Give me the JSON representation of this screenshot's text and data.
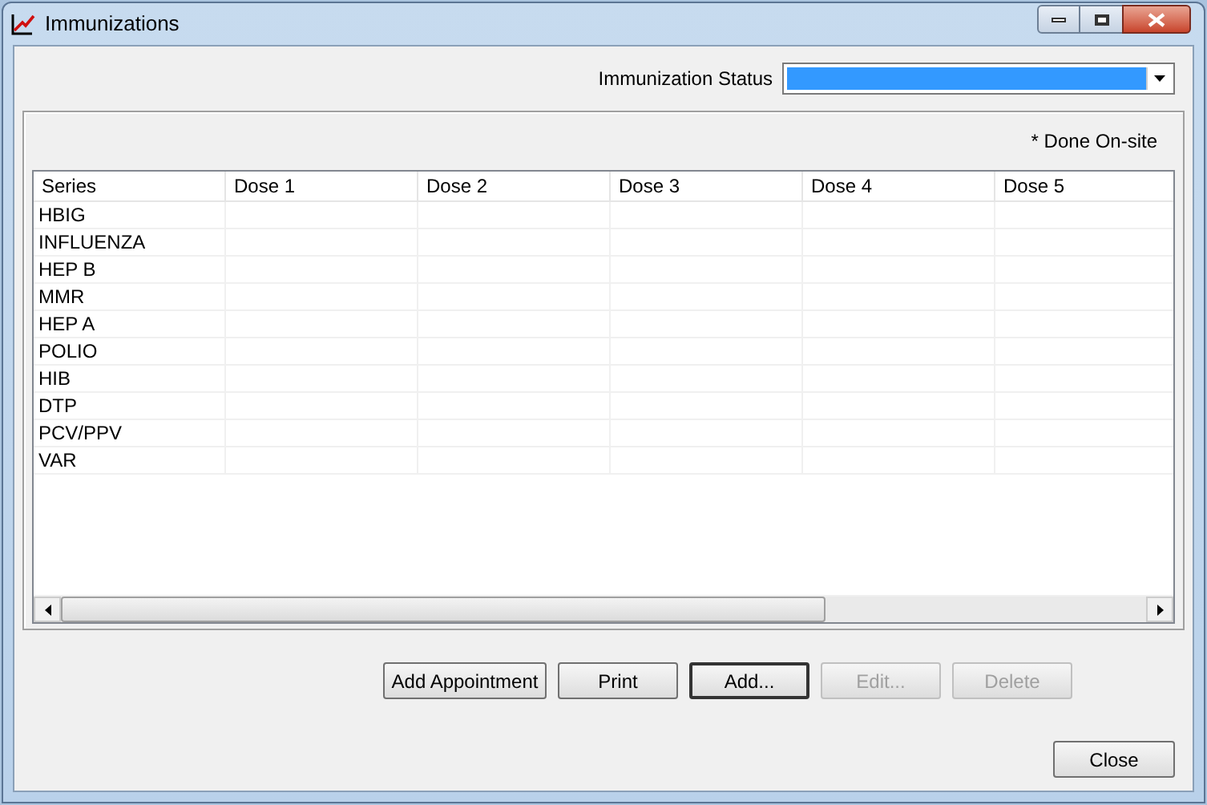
{
  "window": {
    "title": "Immunizations"
  },
  "status": {
    "label": "Immunization Status"
  },
  "legend": "* Done On-site",
  "table": {
    "columns": [
      "Series",
      "Dose 1",
      "Dose 2",
      "Dose 3",
      "Dose 4",
      "Dose 5"
    ],
    "rows": [
      {
        "series": "HBIG"
      },
      {
        "series": "INFLUENZA"
      },
      {
        "series": "HEP B"
      },
      {
        "series": "MMR"
      },
      {
        "series": "HEP A"
      },
      {
        "series": "POLIO"
      },
      {
        "series": "HIB"
      },
      {
        "series": "DTP"
      },
      {
        "series": "PCV/PPV"
      },
      {
        "series": "VAR"
      }
    ]
  },
  "buttons": [
    {
      "label": "Add Appointment",
      "disabled": false,
      "default": false
    },
    {
      "label": "Print",
      "disabled": false,
      "default": false
    },
    {
      "label": "Add...",
      "disabled": false,
      "default": true
    },
    {
      "label": "Edit...",
      "disabled": true,
      "default": false
    },
    {
      "label": "Delete",
      "disabled": true,
      "default": false
    }
  ],
  "close": "Close"
}
